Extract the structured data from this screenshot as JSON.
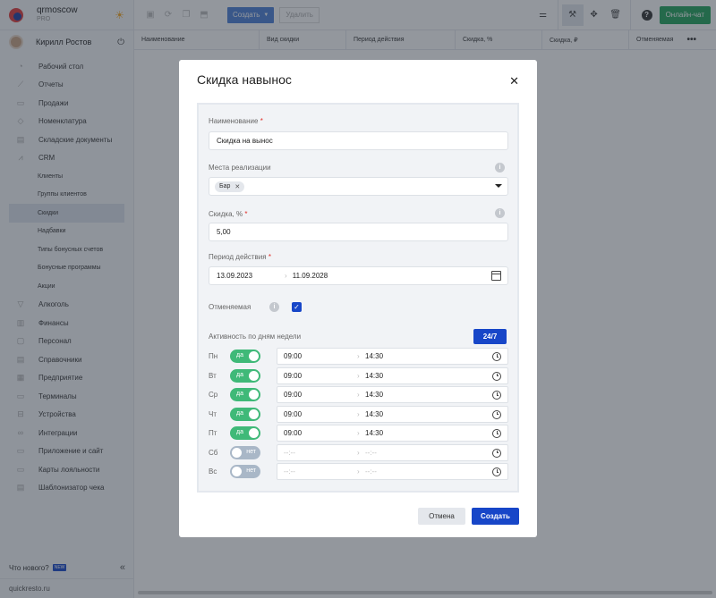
{
  "brand": {
    "name": "qrmoscow",
    "plan": "PRO"
  },
  "user": {
    "name": "Кирилл Ростов"
  },
  "nav": [
    {
      "label": "Рабочий стол",
      "icon": "dashboard-icon"
    },
    {
      "label": "Отчеты",
      "icon": "reports-icon"
    },
    {
      "label": "Продажи",
      "icon": "sales-icon"
    },
    {
      "label": "Номенклатура",
      "icon": "tag-icon"
    },
    {
      "label": "Складские документы",
      "icon": "warehouse-icon"
    },
    {
      "label": "CRM",
      "icon": "crm-icon"
    },
    {
      "label": "Клиенты",
      "sub": true
    },
    {
      "label": "Группы клиентов",
      "sub": true
    },
    {
      "label": "Скидки",
      "sub": true,
      "active": true
    },
    {
      "label": "Надбавки",
      "sub": true
    },
    {
      "label": "Типы бонусных счетов",
      "sub": true
    },
    {
      "label": "Бонусные программы",
      "sub": true
    },
    {
      "label": "Акции",
      "sub": true
    },
    {
      "label": "Алкоголь",
      "icon": "glass-icon"
    },
    {
      "label": "Финансы",
      "icon": "finance-icon"
    },
    {
      "label": "Персонал",
      "icon": "staff-icon"
    },
    {
      "label": "Справочники",
      "icon": "book-icon"
    },
    {
      "label": "Предприятие",
      "icon": "building-icon"
    },
    {
      "label": "Терминалы",
      "icon": "terminal-icon"
    },
    {
      "label": "Устройства",
      "icon": "printer-icon"
    },
    {
      "label": "Интеграции",
      "icon": "integration-icon"
    },
    {
      "label": "Приложение и сайт",
      "icon": "app-icon"
    },
    {
      "label": "Карты лояльности",
      "icon": "card-icon"
    },
    {
      "label": "Шаблонизатор чека",
      "icon": "receipt-icon"
    }
  ],
  "footer": {
    "whats_new": "Что нового?",
    "new_badge": "NEW",
    "site": "quickresto.ru"
  },
  "toolbar": {
    "create": "Создать",
    "delete": "Удалить",
    "chat": "Онлайн-чат"
  },
  "table": {
    "columns": [
      "Наименование",
      "Вид скидки",
      "Период действия",
      "Скидка, %",
      "Скидка, ₽",
      "Отменяемая"
    ]
  },
  "modal": {
    "title": "Скидка навынос",
    "name_label": "Наименование",
    "name_value": "Скидка на вынос",
    "places_label": "Места реализации",
    "places_tag": "Бар",
    "discount_label": "Скидка, %",
    "discount_value": "5,00",
    "period_label": "Период действия",
    "period_from": "13.09.2023",
    "period_to": "11.09.2028",
    "cancelable_label": "Отменяемая",
    "activity_label": "Активность по дням недели",
    "btn_247": "24/7",
    "days": [
      {
        "day": "Пн",
        "on": true,
        "toggle": "да",
        "from": "09:00",
        "to": "14:30"
      },
      {
        "day": "Вт",
        "on": true,
        "toggle": "да",
        "from": "09:00",
        "to": "14:30"
      },
      {
        "day": "Ср",
        "on": true,
        "toggle": "да",
        "from": "09:00",
        "to": "14:30"
      },
      {
        "day": "Чт",
        "on": true,
        "toggle": "да",
        "from": "09:00",
        "to": "14:30"
      },
      {
        "day": "Пт",
        "on": true,
        "toggle": "да",
        "from": "09:00",
        "to": "14:30"
      },
      {
        "day": "Сб",
        "on": false,
        "toggle": "нет",
        "from": "--:--",
        "to": "--:--"
      },
      {
        "day": "Вс",
        "on": false,
        "toggle": "нет",
        "from": "--:--",
        "to": "--:--"
      }
    ],
    "cancel": "Отмена",
    "create": "Создать"
  },
  "colors": {
    "primary": "#1746c8",
    "toggle_on": "#3fb978",
    "toggle_off": "#a9b7c7",
    "chat": "#21a35a"
  }
}
